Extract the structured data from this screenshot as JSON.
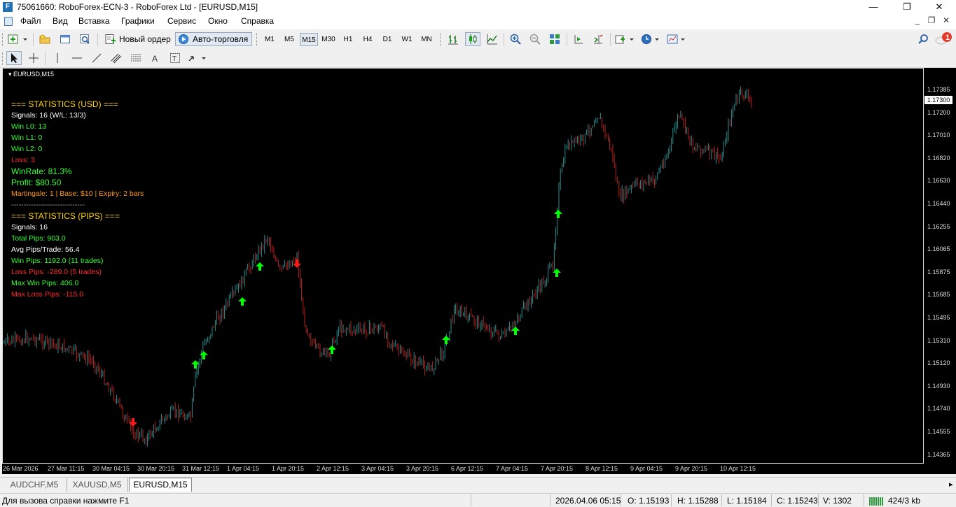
{
  "window": {
    "title": "75061660: RoboForex-ECN-3 - RoboForex Ltd - [EURUSD,M15]",
    "minimize": "—",
    "restore": "❐",
    "close": "✕"
  },
  "menu": {
    "items": [
      "Файл",
      "Вид",
      "Вставка",
      "Графики",
      "Сервис",
      "Окно",
      "Справка"
    ],
    "mdi_minimize": "_",
    "mdi_restore": "❐",
    "mdi_close": "✕"
  },
  "toolbar": {
    "new_order": "Новый ордер",
    "auto_trading": "Авто-торговля",
    "timeframes": [
      "M1",
      "M5",
      "M15",
      "M30",
      "H1",
      "H4",
      "D1",
      "W1",
      "MN"
    ],
    "active_timeframe": "M15",
    "notification_count": "1"
  },
  "chart": {
    "label": "EURUSD,M15",
    "current_price": "1.17300",
    "colors": {
      "background": "#000000",
      "bull": "#2e8b8b",
      "bear": "#b22222",
      "buy_arrow": "#00ff00",
      "sell_arrow": "#ff1a1a"
    },
    "price_labels": [
      "1.17385",
      "1.17200",
      "1.17010",
      "1.16820",
      "1.16630",
      "1.16440",
      "1.16255",
      "1.16065",
      "1.15875",
      "1.15685",
      "1.15495",
      "1.15310",
      "1.15120",
      "1.14930",
      "1.14740",
      "1.14555",
      "1.14365"
    ],
    "time_labels": [
      "26 Mar 2026",
      "27 Mar 11:15",
      "30 Mar 04:15",
      "30 Mar 20:15",
      "31 Mar 12:15",
      "1 Apr 04:15",
      "1 Apr 20:15",
      "2 Apr 12:15",
      "3 Apr 04:15",
      "3 Apr 20:15",
      "6 Apr 12:15",
      "7 Apr 04:15",
      "7 Apr 20:15",
      "8 Apr 12:15",
      "9 Apr 04:15",
      "9 Apr 20:15",
      "10 Apr 12:15"
    ],
    "stats": [
      {
        "text": "=== STATISTICS (USD) ===",
        "color": "#ffd400",
        "large": true
      },
      {
        "text": "Signals: 16 (W/L: 13/3)",
        "color": "#ffffff"
      },
      {
        "text": "Win L0: 13",
        "color": "#33ff33"
      },
      {
        "text": "Win L1: 0",
        "color": "#33ff33"
      },
      {
        "text": "Win L2: 0",
        "color": "#33ff33"
      },
      {
        "text": "Loss: 3",
        "color": "#ff2a2a"
      },
      {
        "text": "WinRate: 81.3%",
        "color": "#33ff33",
        "large": true
      },
      {
        "text": "Profit: $80.50",
        "color": "#33ff33",
        "large": true
      },
      {
        "text": "Martingale: 1 | Base: $10 | Expiry: 2 bars",
        "color": "#ff9a1a"
      },
      {
        "text": "------------------------------",
        "color": "#aaaaaa"
      },
      {
        "text": "=== STATISTICS (PIPS) ===",
        "color": "#ffd400",
        "large": true
      },
      {
        "text": "Signals: 16",
        "color": "#ffffff"
      },
      {
        "text": "Total Pips: 903.0",
        "color": "#33ff33"
      },
      {
        "text": "Avg Pips/Trade: 56.4",
        "color": "#ffffff"
      },
      {
        "text": "Win Pips: 1192.0 (11 trades)",
        "color": "#33ff33"
      },
      {
        "text": "Loss Pips: -289.0 (5 trades)",
        "color": "#ff2a2a"
      },
      {
        "text": "Max Win Pips: 406.0",
        "color": "#33ff33"
      },
      {
        "text": "Max Loss Pips: -115.0",
        "color": "#ff2a2a"
      }
    ]
  },
  "tabs": [
    {
      "label": "AUDCHF,M5",
      "active": false
    },
    {
      "label": "XAUUSD,M5",
      "active": false
    },
    {
      "label": "EURUSD,M15",
      "active": true
    }
  ],
  "status": {
    "help": "Для вызова справки нажмите F1",
    "datetime": "2026.04.06 05:15",
    "open": "O: 1.15193",
    "high": "H: 1.15288",
    "low": "L: 1.15184",
    "close": "C: 1.15243",
    "volume": "V: 1302",
    "traffic": "424/3 kb"
  }
}
